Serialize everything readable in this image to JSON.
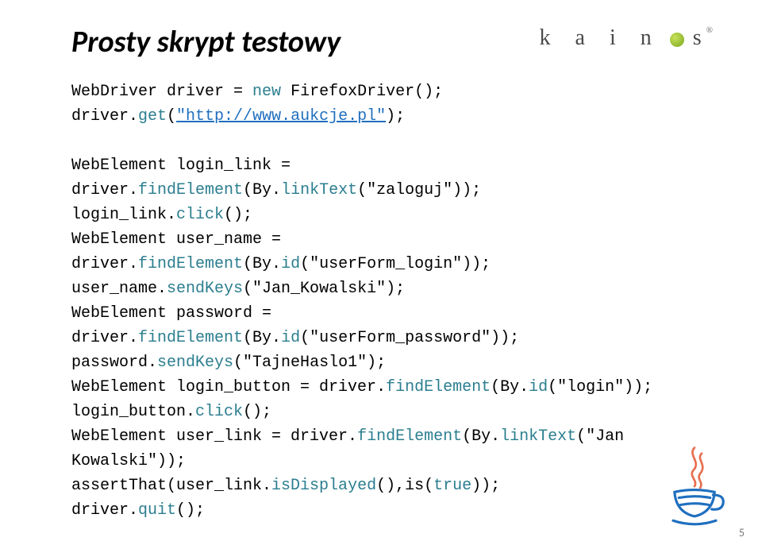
{
  "title": "Prosty skrypt testowy",
  "logo": {
    "k": "k",
    "a": "a",
    "i": "i",
    "n": "n",
    "s": "s",
    "reg_mark": "®"
  },
  "code": {
    "line1_pre": "WebDriver driver = ",
    "line1_new": "new",
    "line1_post": " FirefoxDriver();",
    "line2_pre": "driver.",
    "line2_get": "get",
    "line2_open": "(",
    "line2_url": "\"http://www.aukcje.pl\"",
    "line2_close": ");",
    "line4": "WebElement login_link = driver.",
    "line4_find": "findElement",
    "line4_mid": "(By.",
    "line4_lt": "linkText",
    "line4_arg": "(\"zaloguj\"));",
    "line5": "login_link.",
    "line5_click": "click",
    "line5_end": "();",
    "line6": "WebElement user_name = driver.",
    "line6_find": "findElement",
    "line6_mid": "(By.",
    "line6_id": "id",
    "line6_arg": "(\"userForm_login\"));",
    "line7": "user_name.",
    "line7_send": "sendKeys",
    "line7_arg": "(\"Jan_Kowalski\");",
    "line8": "WebElement password =",
    "line9": "driver.",
    "line9_find": "findElement",
    "line9_mid": "(By.",
    "line9_id": "id",
    "line9_arg": "(\"userForm_password\"));",
    "line10": "password.",
    "line10_send": "sendKeys",
    "line10_arg": "(\"TajneHaslo1\");",
    "line11": "WebElement login_button = driver.",
    "line11_find": "findElement",
    "line11_mid": "(By.",
    "line11_id": "id",
    "line11_arg": "(\"login\"));",
    "line12": "login_button.",
    "line12_click": "click",
    "line12_end": "();",
    "line13": "WebElement user_link = driver.",
    "line13_find": "findElement",
    "line13_mid": "(By.",
    "line13_lt": "linkText",
    "line13_arg": "(\"Jan Kowalski\"));",
    "line14_pre": "assertThat(user_link.",
    "line14_disp": "isDisplayed",
    "line14_mid": "(),is(",
    "line14_true": "true",
    "line14_end": "));",
    "line15": "driver.",
    "line15_quit": "quit",
    "line15_end": "();"
  },
  "page_number": "5"
}
